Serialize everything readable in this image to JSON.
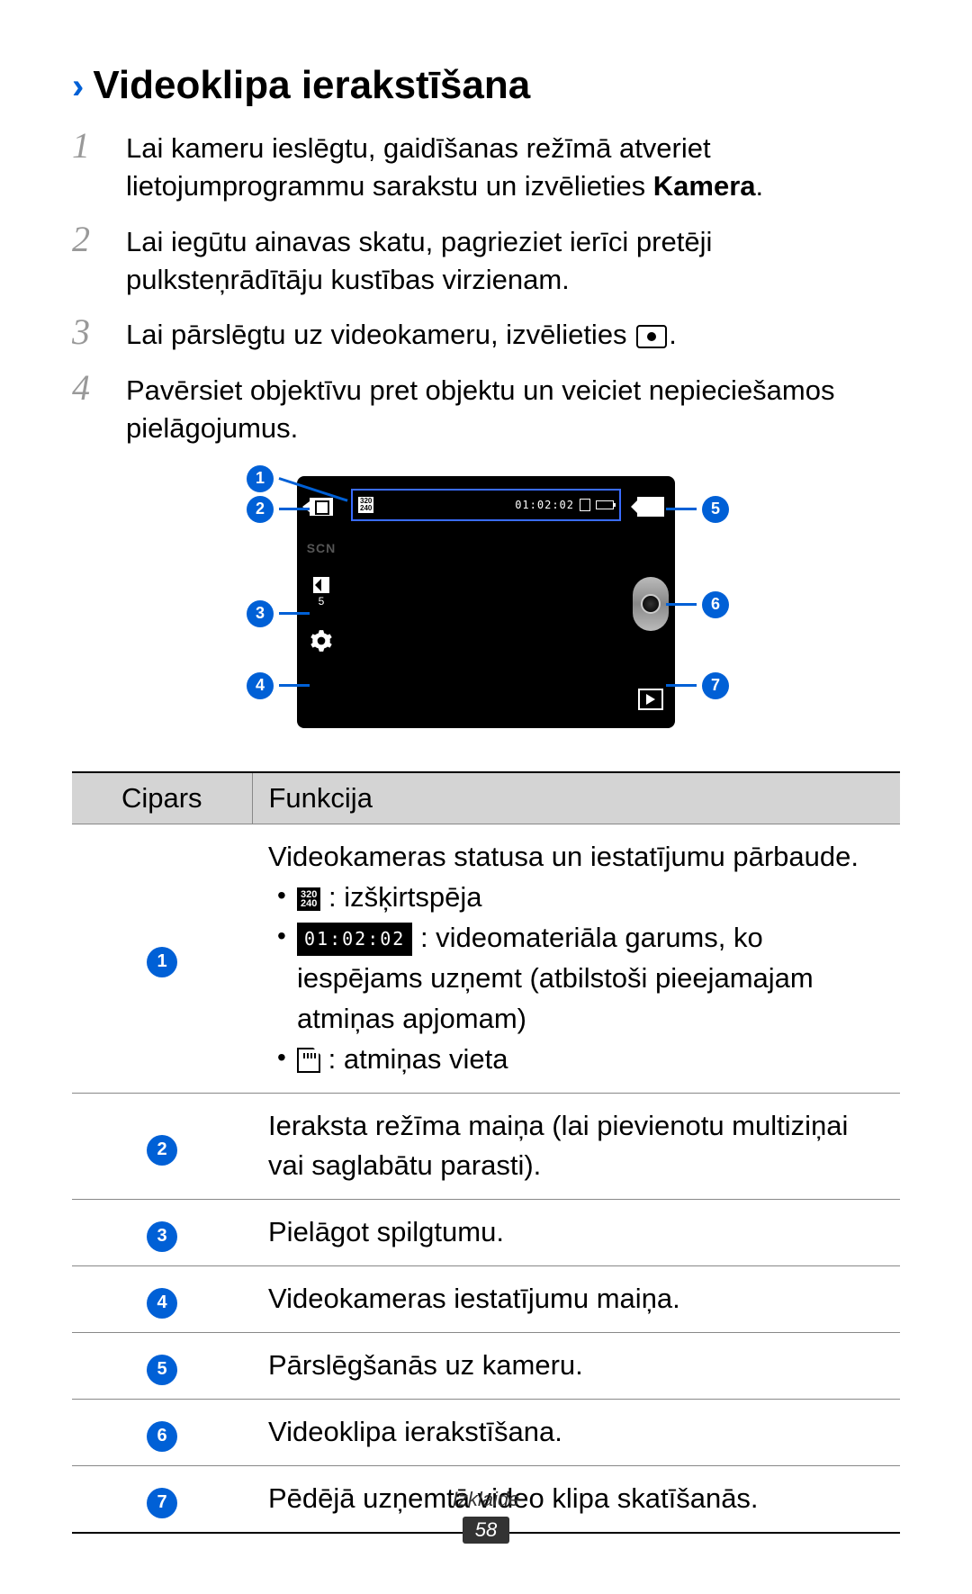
{
  "title": "Videoklipa ierakstīšana",
  "steps": {
    "s1_a": "Lai kameru ieslēgtu, gaidīšanas režīmā atveriet lietojumprogrammu sarakstu un izvēlieties ",
    "s1_bold": "Kamera",
    "s1_b": ".",
    "s2": "Lai iegūtu ainavas skatu, pagrieziet ierīci pretēji pulksteņrādītāju kustības virzienam.",
    "s3_a": "Lai pārslēgtu uz videokameru, izvēlieties ",
    "s3_b": ".",
    "s4": "Pavērsiet objektīvu pret objektu un veiciet nepieciešamos pielāgojumus."
  },
  "diagram": {
    "resolution_top": "320",
    "resolution_bottom": "240",
    "time": "01:02:02",
    "scn": "SCN",
    "brightness_value": "5",
    "callouts": [
      "1",
      "2",
      "3",
      "4",
      "5",
      "6",
      "7"
    ]
  },
  "table": {
    "head_num": "Cipars",
    "head_func": "Funkcija",
    "rows": {
      "r1": {
        "num": "1",
        "intro": "Videokameras statusa un iestatījumu pārbaude.",
        "li1": " : izšķirtspēja",
        "li2_a": " : videomateriāla garums, ko iespējams uzņemt (atbilstoši pieejamajam atmiņas apjomam)",
        "li3": " : atmiņas vieta",
        "res_top": "320",
        "res_bottom": "240",
        "time": "01:02:02"
      },
      "r2": {
        "num": "2",
        "text": "Ieraksta režīma maiņa (lai pievienotu multiziņai vai saglabātu parasti)."
      },
      "r3": {
        "num": "3",
        "text": "Pielāgot spilgtumu."
      },
      "r4": {
        "num": "4",
        "text": "Videokameras iestatījumu maiņa."
      },
      "r5": {
        "num": "5",
        "text": "Pārslēgšanās uz kameru."
      },
      "r6": {
        "num": "6",
        "text": "Videoklipa ierakstīšana."
      },
      "r7": {
        "num": "7",
        "text": "Pēdējā uzņemtā video klipa skatīšanās."
      }
    }
  },
  "footer": {
    "section": "Izklaide",
    "page": "58"
  }
}
